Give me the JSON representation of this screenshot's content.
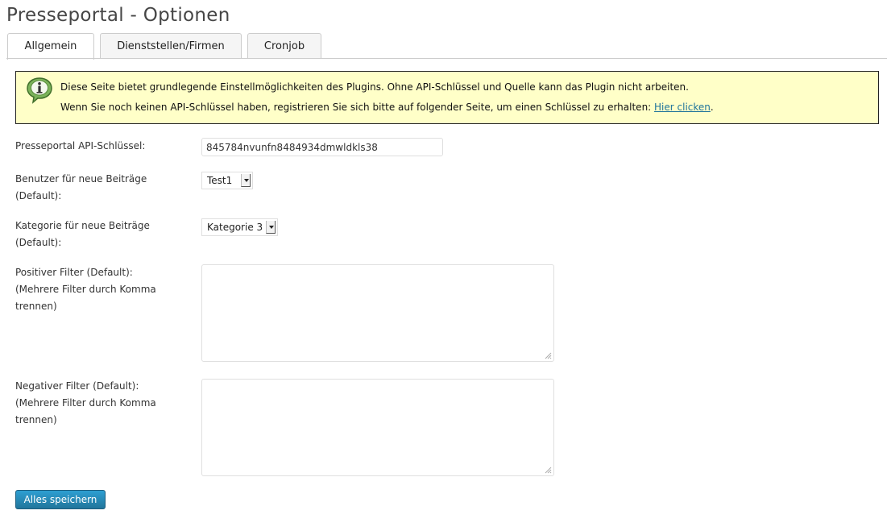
{
  "page": {
    "title": "Presseportal - Optionen"
  },
  "tabs": [
    {
      "label": "Allgemein"
    },
    {
      "label": "Dienststellen/Firmen"
    },
    {
      "label": "Cronjob"
    }
  ],
  "notice": {
    "icon": "info-bubble-icon",
    "line1": "Diese Seite bietet grundlegende Einstellmöglichkeiten des Plugins. Ohne API-Schlüssel und Quelle kann das Plugin nicht arbeiten.",
    "line2": "Wenn Sie noch keinen API-Schlüssel haben, registrieren Sie sich bitte auf folgender Seite, um einen Schlüssel zu erhalten: ",
    "link": "Hier clicken",
    "after_link": ".",
    "background_color": "#ffffc8"
  },
  "form": {
    "api_key": {
      "label": "Presseportal API-Schlüssel:",
      "value": "845784nvunfn8484934dmwldkls38"
    },
    "user": {
      "label_line1": "Benutzer für neue Beiträge",
      "label_line2": "(Default):",
      "selected": "Test1"
    },
    "category": {
      "label_line1": "Kategorie für neue Beiträge",
      "label_line2": "(Default):",
      "selected": "Kategorie 3"
    },
    "positive_filter": {
      "label_line1": "Positiver Filter (Default):",
      "label_line2": "(Mehrere Filter durch Komma",
      "label_line3": "trennen)",
      "value": ""
    },
    "negative_filter": {
      "label_line1": "Negativer Filter (Default):",
      "label_line2": "(Mehrere Filter durch Komma",
      "label_line3": "trennen)",
      "value": ""
    },
    "save_label": "Alles speichern",
    "accent_color": "#21759b"
  }
}
